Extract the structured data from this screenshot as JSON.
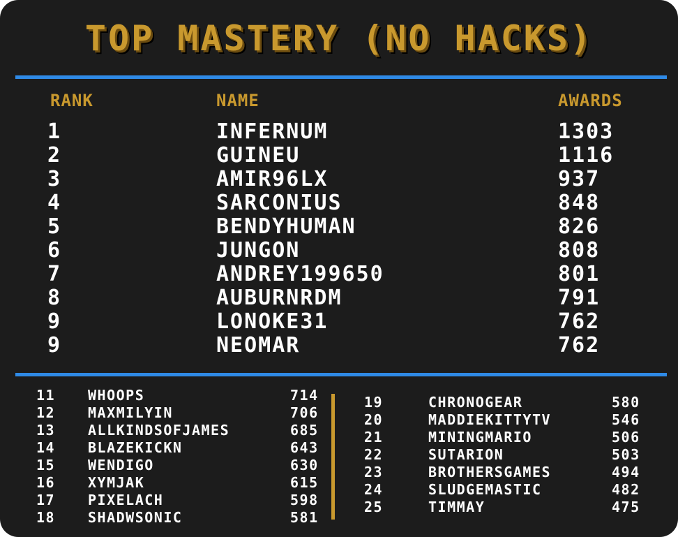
{
  "title": "TOP MASTERY (NO HACKS)",
  "headers": {
    "rank": "RANK",
    "name": "NAME",
    "awards": "AWARDS"
  },
  "top_ten": [
    {
      "rank": "1",
      "name": "INFERNUM",
      "awards": "1303"
    },
    {
      "rank": "2",
      "name": "GUINEU",
      "awards": "1116"
    },
    {
      "rank": "3",
      "name": "AMIR96LX",
      "awards": "937"
    },
    {
      "rank": "4",
      "name": "SARCONIUS",
      "awards": "848"
    },
    {
      "rank": "5",
      "name": "BENDYHUMAN",
      "awards": "826"
    },
    {
      "rank": "6",
      "name": "JUNGON",
      "awards": "808"
    },
    {
      "rank": "7",
      "name": "ANDREY199650",
      "awards": "801"
    },
    {
      "rank": "8",
      "name": "AUBURNRDM",
      "awards": "791"
    },
    {
      "rank": "9",
      "name": "LONOKE31",
      "awards": "762"
    },
    {
      "rank": "9",
      "name": "NEOMAR",
      "awards": "762"
    }
  ],
  "left_column": [
    {
      "rank": "11",
      "name": "WHOOPS",
      "awards": "714"
    },
    {
      "rank": "12",
      "name": "MAXMILYIN",
      "awards": "706"
    },
    {
      "rank": "13",
      "name": "ALLKINDSOFJAMES",
      "awards": "685"
    },
    {
      "rank": "14",
      "name": "BLAZEKICKN",
      "awards": "643"
    },
    {
      "rank": "15",
      "name": "WENDIGO",
      "awards": "630"
    },
    {
      "rank": "16",
      "name": "XYMJAK",
      "awards": "615"
    },
    {
      "rank": "17",
      "name": "PIXELACH",
      "awards": "598"
    },
    {
      "rank": "18",
      "name": "SHADWSONIC",
      "awards": "581"
    }
  ],
  "right_column": [
    {
      "rank": "19",
      "name": "CHRONOGEAR",
      "awards": "580"
    },
    {
      "rank": "20",
      "name": "MADDIEKITTYTV",
      "awards": "546"
    },
    {
      "rank": "21",
      "name": "MININGMARIO",
      "awards": "506"
    },
    {
      "rank": "22",
      "name": "SUTARION",
      "awards": "503"
    },
    {
      "rank": "23",
      "name": "BROTHERSGAMES",
      "awards": "494"
    },
    {
      "rank": "24",
      "name": "SLUDGEMASTIC",
      "awards": "482"
    },
    {
      "rank": "25",
      "name": "TIMMAY",
      "awards": "475"
    }
  ],
  "colors": {
    "background": "#1c1c1c",
    "gold": "#c9992e",
    "blue": "#2f8ae6",
    "text": "#ffffff"
  }
}
